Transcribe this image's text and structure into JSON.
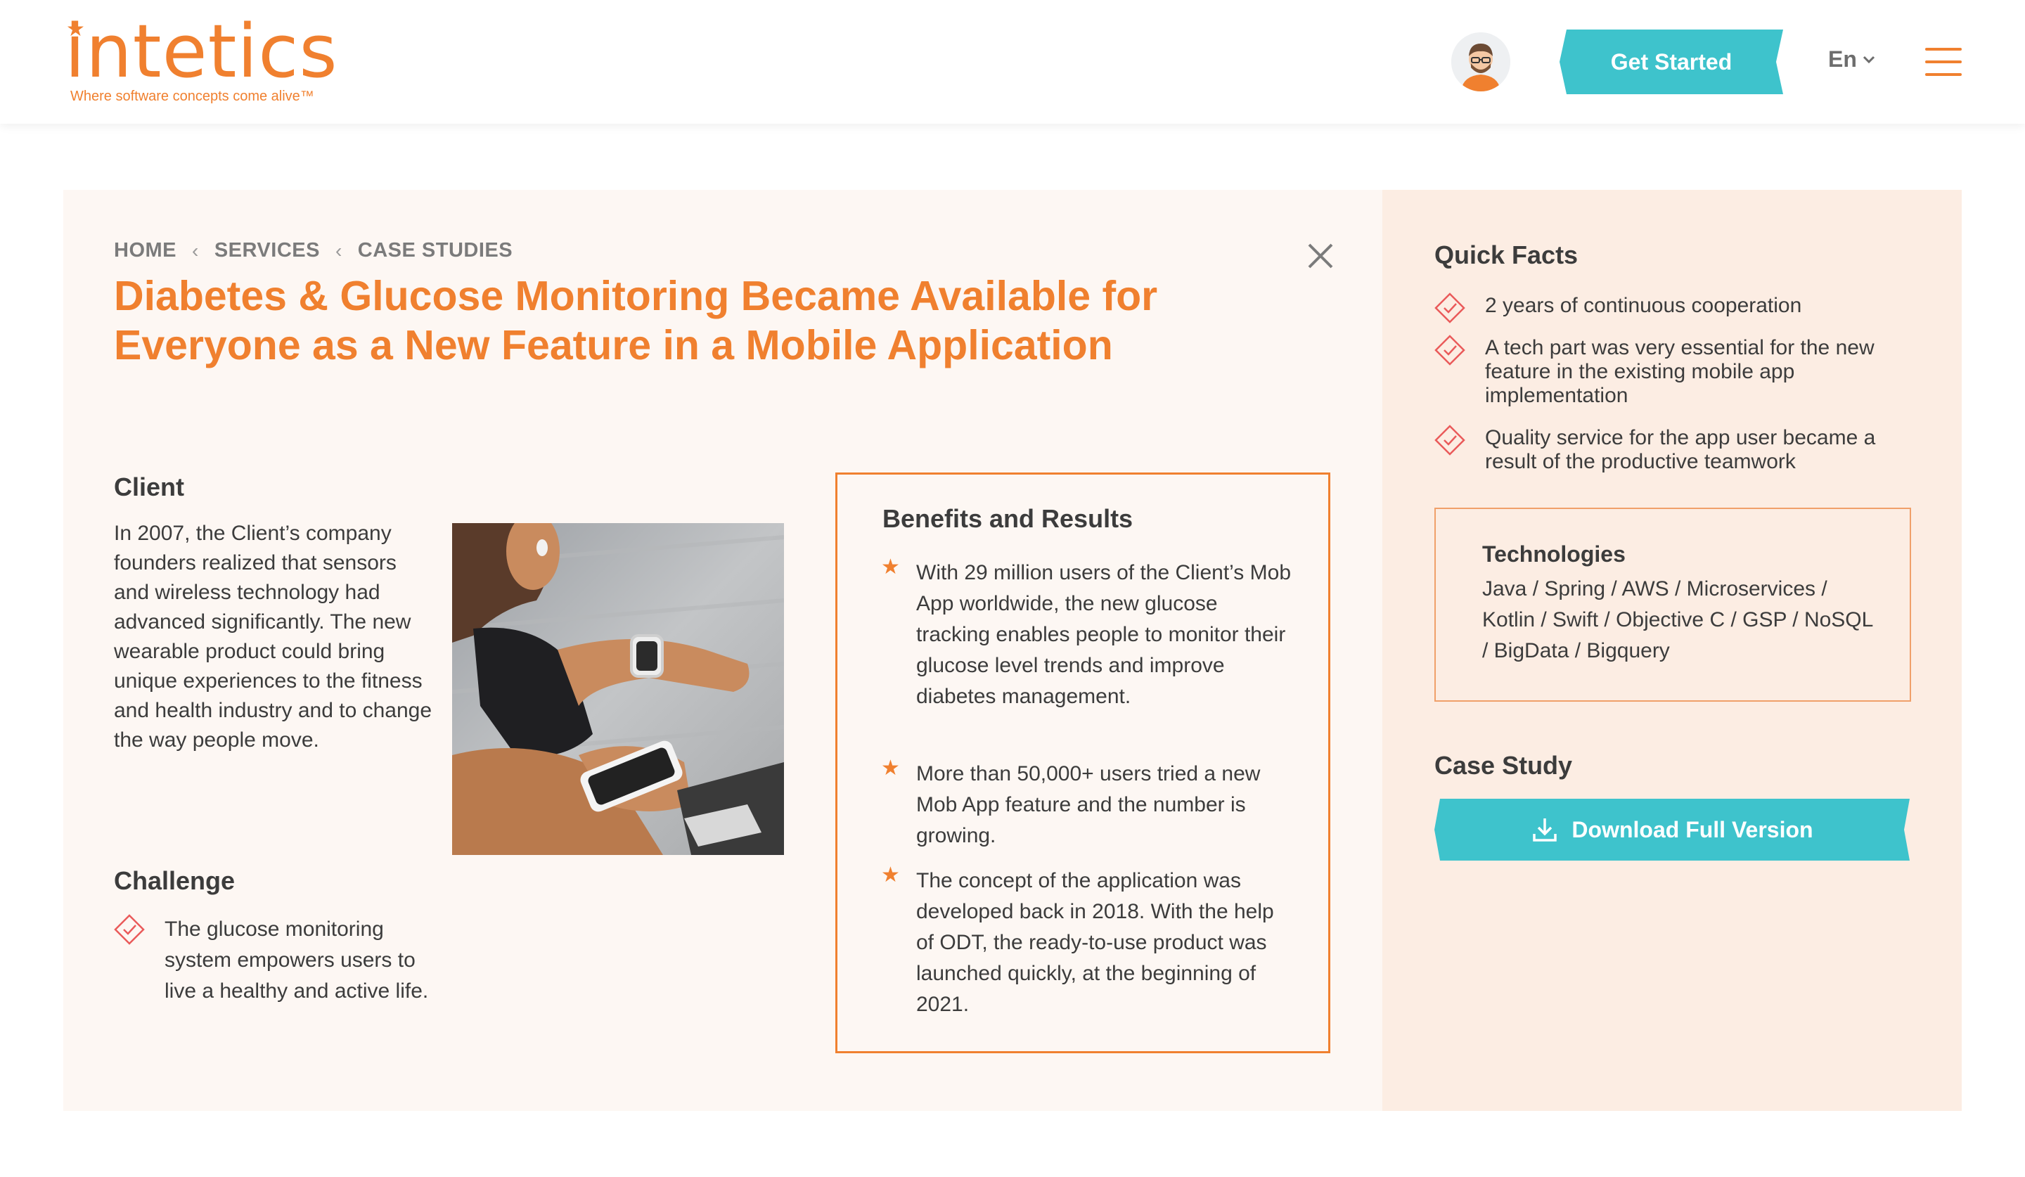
{
  "header": {
    "logo_text": "intetics",
    "logo_tagline": "Where software concepts come alive™",
    "cta_label": "Get Started",
    "language": "En"
  },
  "breadcrumb": [
    "HOME",
    "SERVICES",
    "CASE STUDIES"
  ],
  "title": "Diabetes & Glucose Monitoring Became Available for Everyone as a New Feature in a Mobile Application",
  "client": {
    "heading": "Client",
    "text": "In 2007, the Client’s company founders realized that sensors and wireless technology had advanced significantly. The new wearable product could bring unique experiences to the fitness and health industry and to change the way people move."
  },
  "challenge": {
    "heading": "Challenge",
    "items": [
      "The glucose monitoring system empowers users to live a healthy and active life."
    ]
  },
  "benefits": {
    "heading": "Benefits and Results",
    "items": [
      "With 29 million users of the Client’s Mob App worldwide, the new glucose tracking enables people to monitor their glucose level trends and improve diabetes management.",
      "More than 50,000+ users tried a new Mob App feature and the number is growing.",
      "The concept of the application was developed back in 2018. With the help of ODT, the ready-to-use product was launched quickly, at the beginning of 2021."
    ]
  },
  "quick_facts": {
    "heading": "Quick Facts",
    "items": [
      "2 years of continuous cooperation",
      "A tech part was very essential for the new feature in the existing mobile app implementation",
      "Quality service for the app user became a result of the productive teamwork"
    ]
  },
  "technologies": {
    "heading": "Technologies",
    "text": "Java / Spring / AWS / Microservices / Kotlin / Swift / Objective C / GSP / NoSQL / BigData / Bigquery"
  },
  "case_study": {
    "heading": "Case Study",
    "download_label": "Download Full Version"
  },
  "colors": {
    "brand_orange": "#f0802f",
    "accent_teal": "#3ec3cc",
    "panel_light": "#fdf7f3",
    "panel_peach": "#fcede3"
  },
  "icons": [
    "avatar-icon",
    "chevron-down-icon",
    "hamburger-menu-icon",
    "close-icon",
    "diamond-check-icon",
    "star-bullet-icon",
    "download-icon"
  ]
}
